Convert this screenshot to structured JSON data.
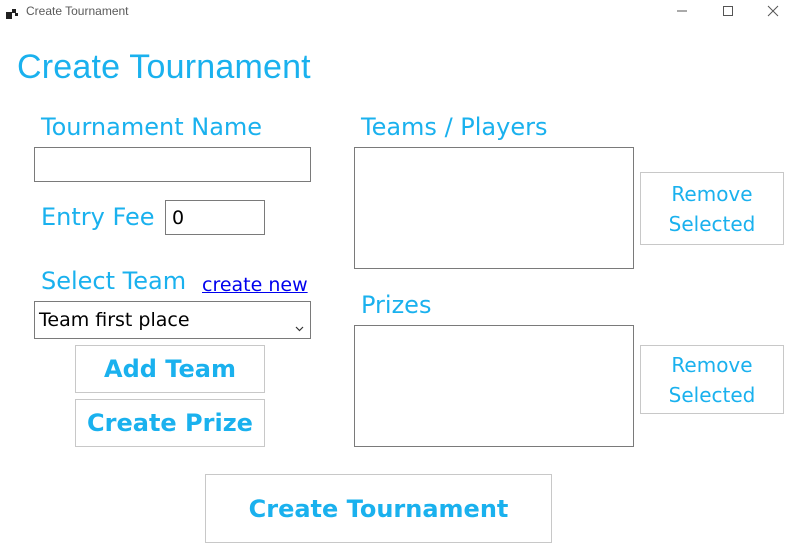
{
  "window": {
    "title": "Create Tournament",
    "icon": "app-icon",
    "controls": [
      "minimize-icon",
      "maximize-icon",
      "close-icon"
    ]
  },
  "form": {
    "heading": "Create Tournament",
    "tournament_name_label": "Tournament Name",
    "tournament_name_value": "",
    "entry_fee_label": "Entry Fee",
    "entry_fee_value": "0",
    "select_team_label": "Select Team",
    "create_new_link": "create new",
    "team_dropdown_value": "Team first place",
    "add_team_button": "Add Team",
    "create_prize_button": "Create Prize",
    "teams_players_label": "Teams / Players",
    "teams_players_items": [],
    "remove_teams_button": [
      "Remove",
      "Selected"
    ],
    "prizes_label": "Prizes",
    "prizes_items": [],
    "remove_prizes_button": [
      "Remove",
      "Selected"
    ],
    "create_tournament_button": "Create Tournament"
  },
  "colors": {
    "accent": "#1ab1ee",
    "link": "#0000ee",
    "border": "#7a7a7a",
    "button_border": "#c8c8c8"
  }
}
